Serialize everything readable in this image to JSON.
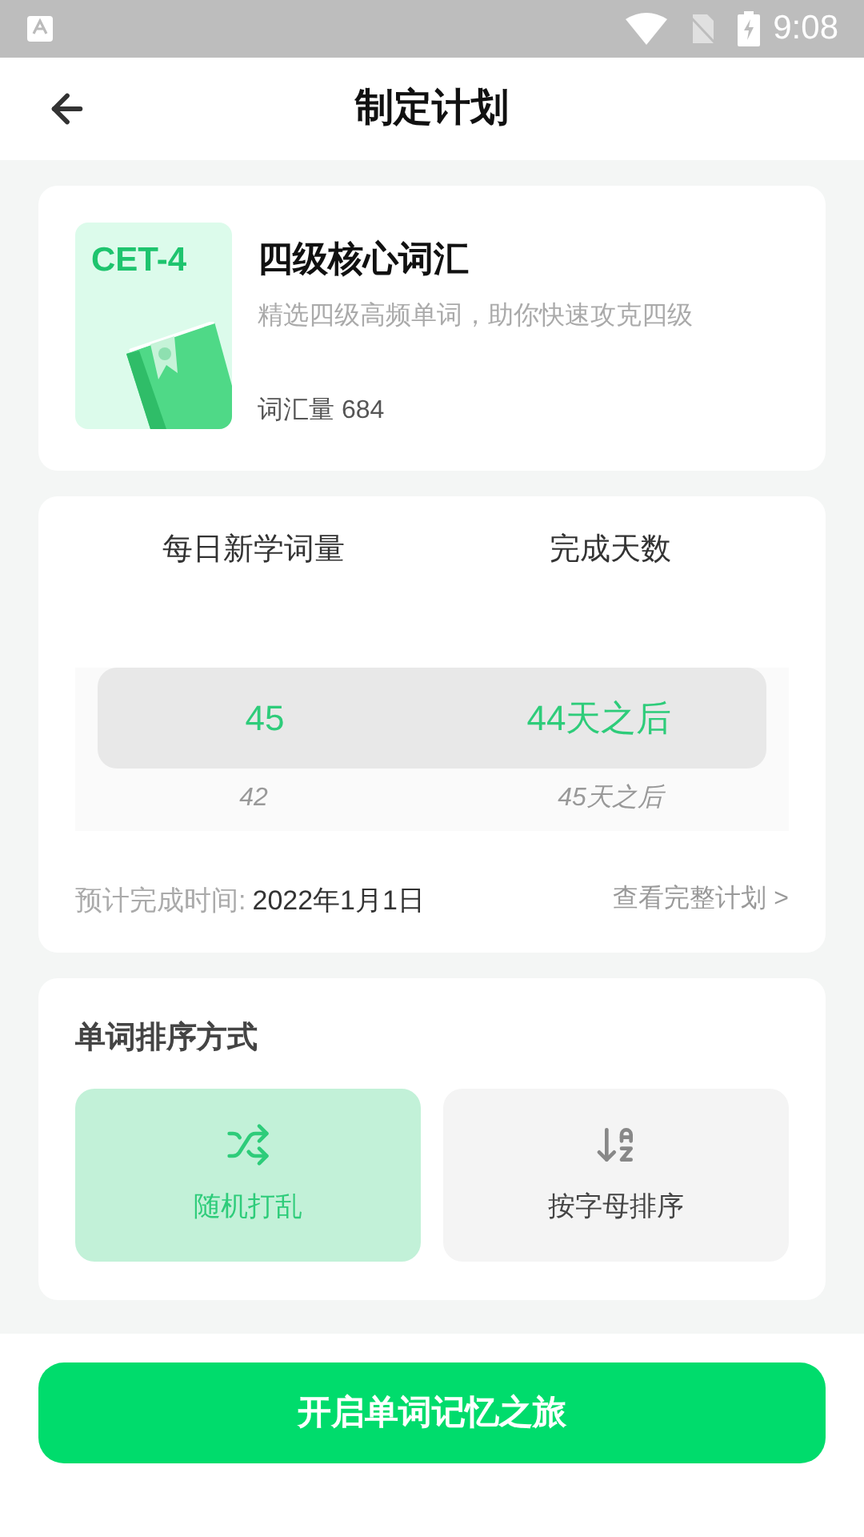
{
  "status_bar": {
    "time": "9:08"
  },
  "header": {
    "title": "制定计划"
  },
  "book": {
    "cover_label": "CET-4",
    "title": "四级核心词汇",
    "description": "精选四级高频单词，助你快速攻克四级",
    "count": "词汇量 684"
  },
  "plan": {
    "columns": [
      {
        "heading": "每日新学词量",
        "options": [
          {
            "value": "45",
            "selected": true
          },
          {
            "value": "42",
            "selected": false
          }
        ]
      },
      {
        "heading": "完成天数",
        "options": [
          {
            "value": "44天之后",
            "selected": true
          },
          {
            "value": "45天之后",
            "selected": false
          }
        ]
      }
    ],
    "finish_label": "预计完成时间:",
    "finish_date": "2022年1月1日",
    "full_plan_link": "查看完整计划 >"
  },
  "sorting": {
    "title": "单词排序方式",
    "options": [
      {
        "kind": "shuffle",
        "label": "随机打乱",
        "selected": true
      },
      {
        "kind": "alphabetical",
        "label": "按字母排序",
        "selected": false
      }
    ]
  },
  "start_button": "开启单词记忆之旅"
}
